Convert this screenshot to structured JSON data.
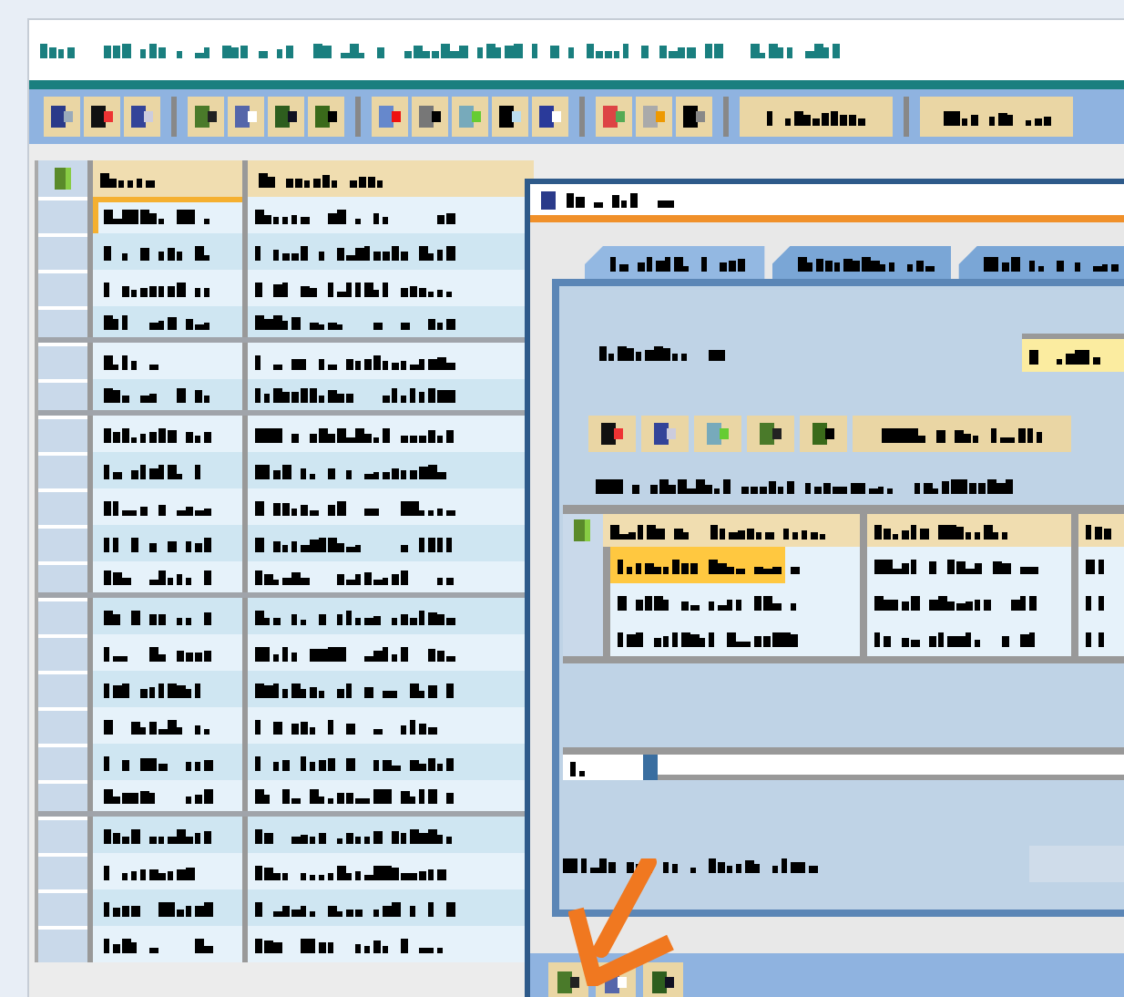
{
  "toolbar": {
    "buttons": [
      {
        "kind": "icon"
      },
      {
        "kind": "icon"
      },
      {
        "kind": "icon"
      },
      {
        "kind": "separator"
      },
      {
        "kind": "icon"
      },
      {
        "kind": "icon"
      },
      {
        "kind": "icon"
      },
      {
        "kind": "icon"
      },
      {
        "kind": "separator"
      },
      {
        "kind": "icon"
      },
      {
        "kind": "icon"
      },
      {
        "kind": "icon"
      },
      {
        "kind": "icon"
      },
      {
        "kind": "icon"
      },
      {
        "kind": "separator"
      },
      {
        "kind": "icon"
      },
      {
        "kind": "icon"
      },
      {
        "kind": "icon"
      },
      {
        "kind": "separator"
      },
      {
        "kind": "wide"
      },
      {
        "kind": "separator"
      },
      {
        "kind": "wide"
      }
    ]
  },
  "table": {
    "rows": [
      {
        "selected": true,
        "group_end": false
      },
      {
        "selected": false,
        "group_end": false
      },
      {
        "selected": false,
        "group_end": false
      },
      {
        "selected": false,
        "group_end": true
      },
      {
        "selected": false,
        "group_end": false
      },
      {
        "selected": false,
        "group_end": true
      },
      {
        "selected": false,
        "group_end": false
      },
      {
        "selected": false,
        "group_end": false
      },
      {
        "selected": false,
        "group_end": false
      },
      {
        "selected": false,
        "group_end": false
      },
      {
        "selected": false,
        "group_end": true
      },
      {
        "selected": false,
        "group_end": false
      },
      {
        "selected": false,
        "group_end": false
      },
      {
        "selected": false,
        "group_end": false
      },
      {
        "selected": false,
        "group_end": false
      },
      {
        "selected": false,
        "group_end": false
      },
      {
        "selected": false,
        "group_end": true
      },
      {
        "selected": false,
        "group_end": false
      },
      {
        "selected": false,
        "group_end": false
      },
      {
        "selected": false,
        "group_end": false
      },
      {
        "selected": false,
        "group_end": false
      }
    ]
  },
  "dialog": {
    "tabs": [
      {
        "selected": true
      },
      {
        "selected": false
      },
      {
        "selected": false
      }
    ],
    "table": {
      "rows": [
        {
          "selected": true
        },
        {
          "selected": false
        },
        {
          "selected": false
        }
      ]
    },
    "footer_buttons": [
      {
        "kind": "icon"
      },
      {
        "kind": "icon"
      },
      {
        "kind": "icon"
      }
    ]
  },
  "annotation": {
    "kind": "arrow",
    "color": "#f07820"
  }
}
